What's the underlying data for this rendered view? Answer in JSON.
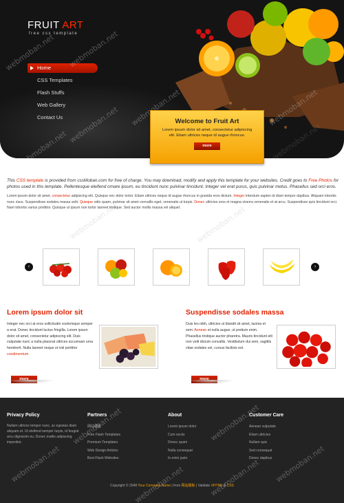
{
  "header": {
    "logo_word1": "FRUIT",
    "logo_word2": "ART",
    "logo_sub": "free css template",
    "nav": [
      {
        "label": "Home",
        "active": true
      },
      {
        "label": "CSS Templates"
      },
      {
        "label": "Flash Stuffs"
      },
      {
        "label": "Web Gallery"
      },
      {
        "label": "Contact Us"
      }
    ]
  },
  "welcome": {
    "title": "Welcome to Fruit Art",
    "text": "Lorem ipsum dolor sit amet, consectetur adipiscing elit. Etiam ultrices neque id augue rhoncus.",
    "button": "more"
  },
  "intro": {
    "lead_part1": "This",
    "lead_link1": "CSS template",
    "lead_part2": "is provided from cssMoban.com for free of charge. You may download, modify and apply this template for your websites. Credit goes to",
    "lead_link2": "Free Photos",
    "lead_part3": "for photos used in this template. Pellentesque eleifend ornare ipsum, eu tincidunt nunc pulvinar tincidunt. Integer vel erat purus, quis pulvinar metus. Phasellus sed orci eros.",
    "body_part1": "Lorem ipsum dolor sit amet,",
    "body_link1": "consectetur",
    "body_part2": "adipiscing elit. Quisque nec dolor tortor. Etiam ultrices neque id augue rhoncus in gravida eros dictum.",
    "body_link2": "Integer",
    "body_part3": "interdum sapien id diam tempor dapibus. Aliquam lobortis nunc risus. Suspendisse sodales massa velit.",
    "body_link3": "Quisque",
    "body_part4": "odio quam, pulvinar sit amet convallis eget, venenatis ut turpis.",
    "body_link4": "Donec",
    "body_part5": "ultricies eros et magna viverra venenatis et at arcu. Suspendisse quis tincidunt orci. Nam lobortis varius porttitor. Quisque ut ipsum non tortor laoreet tristique. Sed auctor mollis massa vel aliquet."
  },
  "gallery": {
    "prev_label": "‹",
    "next_label": "›",
    "thumbs": [
      "tomatoes-icon",
      "mixed-fruit-icon",
      "oranges-icon",
      "strawberries-icon",
      "bananas-icon"
    ]
  },
  "left_col": {
    "title": "Lorem ipsum dolor sit",
    "text_part1": "Integer nec orci at eros sollicitudin scelerisque semper a erat. Donec tincidunt luctus fringilla. Lorem ipsum dolor sit amet, consectetur adipiscing elit. Duis vulputate nunc a nulla placerat ultrices accumsan urna hendrerit. Nulla laoreet neque ut nisl porttitor",
    "text_link": "condimentum",
    "text_part2": ".",
    "button": "more"
  },
  "right_col": {
    "title": "Suspendisse sodales massa",
    "text_part1": "Duis leo nibh, ultricies ut blandit sit amet, lacinia et sem.",
    "text_link": "Aenean",
    "text_part2": "et nulla augue, ut pretium enim. Phasellus tristique auctor pharetra. Mauris tincidunt elit non velit dictum convallis. Vestibulum dui sem, sagittis vitae sodales vel, cursus facilisis est.",
    "button": "more"
  },
  "footer": {
    "privacy": {
      "title": "Privacy Policy",
      "text": "Nullam ultrices tempor nunc, ac egestas diam aliquam et. Ut eleifend semper turpis, id feugiat arcu dignissim eu. Donec mattis adipiscing imperdiet."
    },
    "partners": {
      "title": "Partners",
      "items": [
        "网站模板",
        "Free Flash Templates",
        "Premium Templates",
        "Web Design Articles",
        "Best Flash Websites"
      ]
    },
    "about": {
      "title": "About",
      "items": [
        "Lorem ipsum dolor",
        "Cum sociis",
        "Donec quam",
        "Nulla consequat",
        "In enim justo"
      ]
    },
    "customer_care": {
      "title": "Customer Care",
      "items": [
        "Aenean vulputate",
        "Etiam ultricies",
        "Nullam quis",
        "Sed consequat",
        "Donec dapibus"
      ]
    },
    "copyright_prefix": "Copyright © 2048",
    "company": "Your Company Name",
    "from": "| from",
    "site": "网站模板",
    "validate": "| Validate",
    "xhtml": "XHTML",
    "amp": "&",
    "css": "CSS"
  },
  "watermark": "webmoban.net",
  "colors": {
    "accent": "#e02200",
    "gold": "#f5a100",
    "dark": "#141414"
  }
}
